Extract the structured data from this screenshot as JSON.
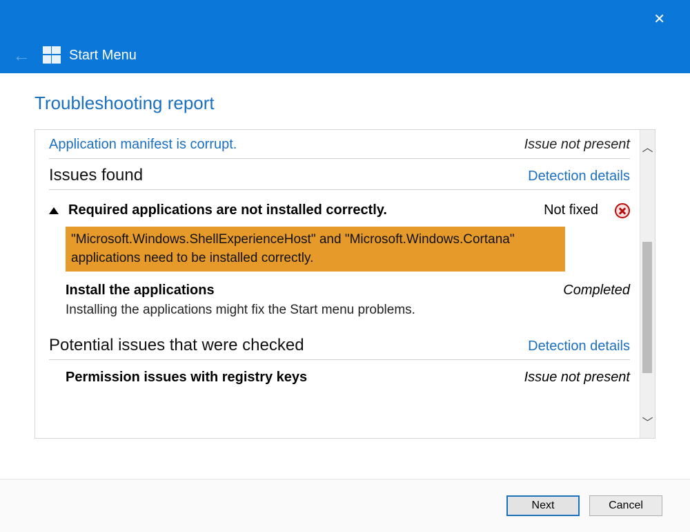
{
  "window": {
    "title": "Start Menu",
    "page_heading": "Troubleshooting report"
  },
  "truncated_issue": {
    "label": "Application manifest is corrupt.",
    "status": "Issue not present"
  },
  "sections": {
    "issues_found": {
      "heading": "Issues found",
      "details_link": "Detection details"
    },
    "potential": {
      "heading": "Potential issues that were checked",
      "details_link": "Detection details"
    }
  },
  "issue": {
    "title": "Required applications are not installed correctly.",
    "status": "Not fixed",
    "highlight": "\"Microsoft.Windows.ShellExperienceHost\" and \"Microsoft.Windows.Cortana\" applications need to be installed correctly.",
    "resolution_label": "Install the applications",
    "resolution_status": "Completed",
    "resolution_desc": "Installing the applications might fix the Start menu problems."
  },
  "potential_item": {
    "label": "Permission issues with registry keys",
    "status": "Issue not present"
  },
  "buttons": {
    "next": "Next",
    "cancel": "Cancel"
  }
}
